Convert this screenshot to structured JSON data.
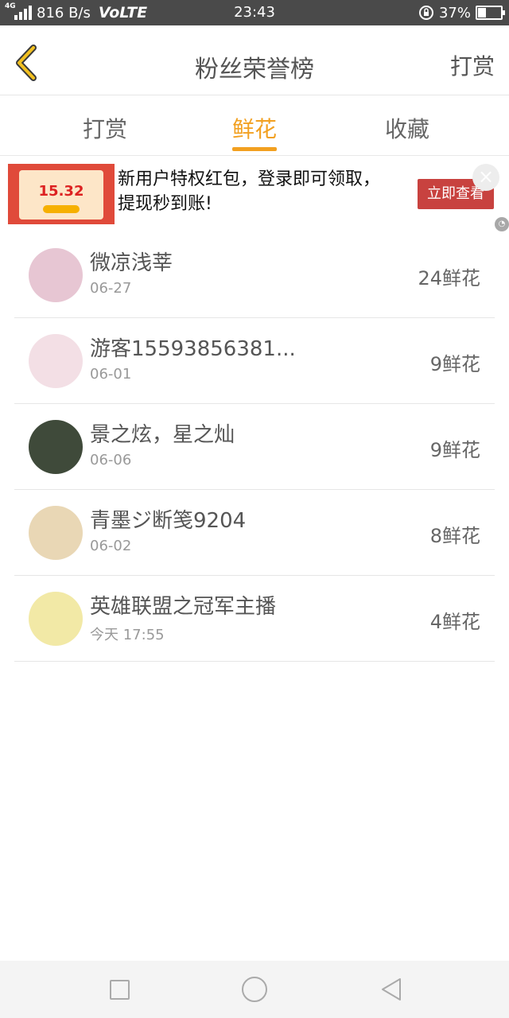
{
  "status_bar": {
    "network_type": "4G",
    "speed": "816 B/s",
    "volte": "VoLTE",
    "time": "23:43",
    "battery_percent": "37%",
    "battery_level": 0.37
  },
  "header": {
    "title": "粉丝荣誉榜",
    "action": "打赏"
  },
  "tabs": [
    {
      "label": "打赏",
      "active": false
    },
    {
      "label": "鲜花",
      "active": true
    },
    {
      "label": "收藏",
      "active": false
    }
  ],
  "ad": {
    "image_amount": "15.32",
    "text": "新用户特权红包，登录即可领取，提现秒到账!",
    "cta": "立即查看",
    "close": "×"
  },
  "list": [
    {
      "name": "微凉浅莘",
      "date": "06-27",
      "count": "24鲜花",
      "avatar_color": "#e7c6d3"
    },
    {
      "name": "游客15593856381...",
      "date": "06-01",
      "count": "9鲜花",
      "avatar_color": "#f3dfe5"
    },
    {
      "name": "景之炫，星之灿",
      "date": "06-06",
      "count": "9鲜花",
      "avatar_color": "#3f4a3a"
    },
    {
      "name": "青墨ジ断笺9204",
      "date": "06-02",
      "count": "8鲜花",
      "avatar_color": "#e9d7b5"
    },
    {
      "name": "英雄联盟之冠军主播",
      "date": "今天 17:55",
      "count": "4鲜花",
      "avatar_color": "#f2e9a6"
    }
  ],
  "colors": {
    "accent": "#f2a020",
    "ad_cta": "#c8423f",
    "status_bar": "#4a4a4a"
  }
}
